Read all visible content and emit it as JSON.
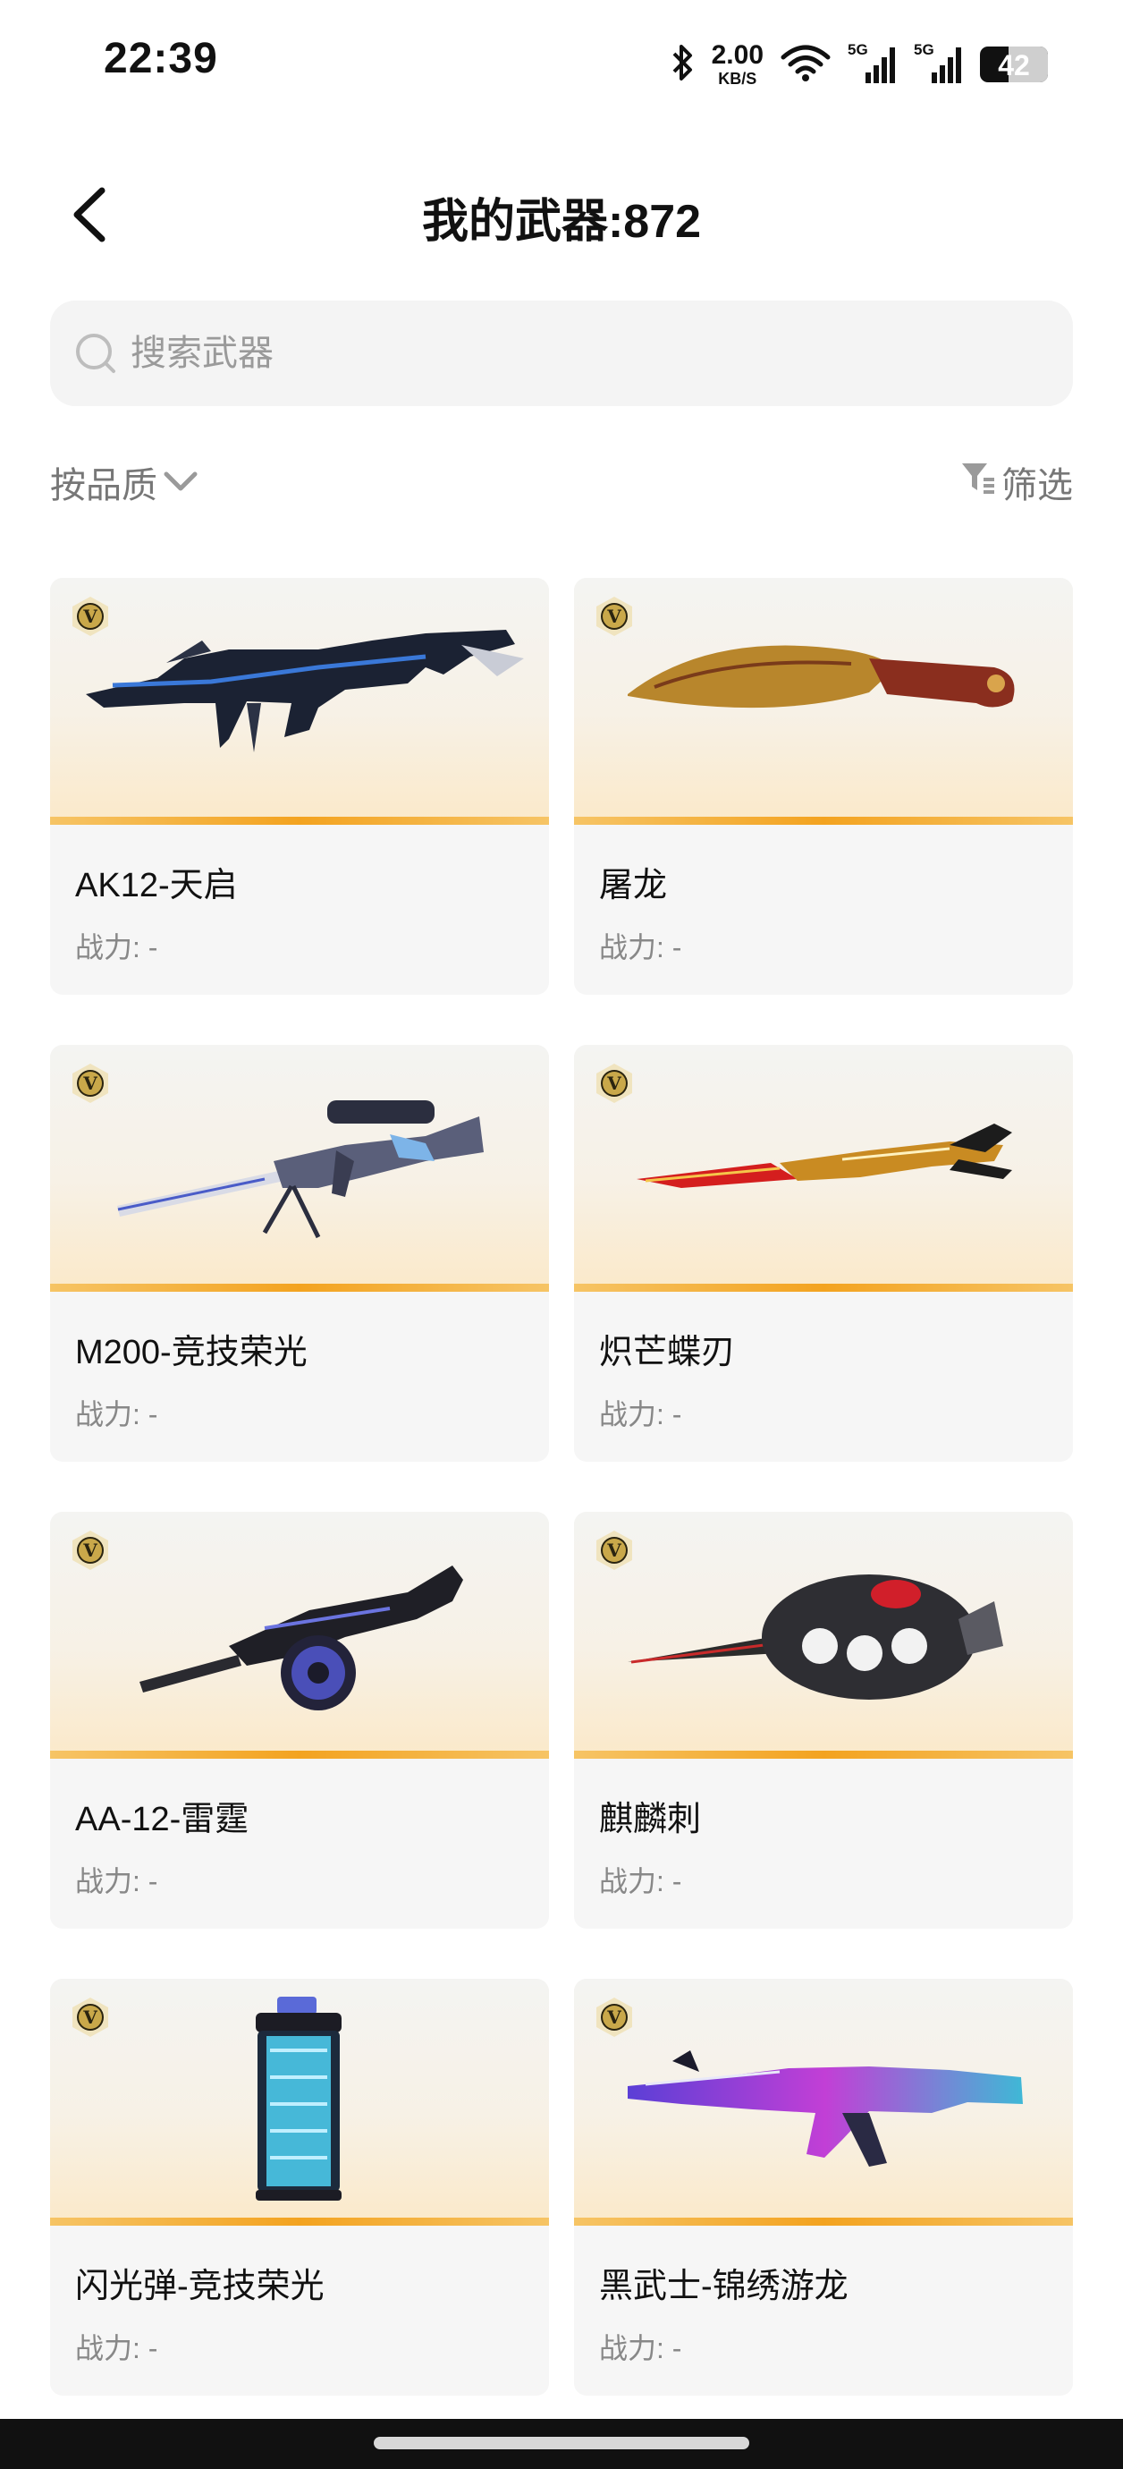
{
  "status_bar": {
    "time": "22:39",
    "net_speed_value": "2.00",
    "net_speed_unit": "KB/S",
    "signal_1_label": "5G",
    "signal_2_label": "5G",
    "battery": "42",
    "icons": [
      "bluetooth-icon",
      "wifi-icon",
      "signal-icon",
      "signal-icon",
      "battery-icon"
    ]
  },
  "header": {
    "title": "我的武器:872",
    "back_icon": "chevron-left-icon"
  },
  "search": {
    "placeholder": "搜索武器",
    "icon": "search-icon"
  },
  "toolbar": {
    "sort_label": "按品质",
    "sort_icon": "chevron-down-icon",
    "filter_label": "筛选",
    "filter_icon": "filter-icon"
  },
  "weapons": [
    {
      "name": "AK12-天启",
      "power": "战力: -",
      "badge": "V",
      "icon": "rifle-icon"
    },
    {
      "name": "屠龙",
      "power": "战力: -",
      "badge": "V",
      "icon": "knife-icon"
    },
    {
      "name": "M200-竞技荣光",
      "power": "战力: -",
      "badge": "V",
      "icon": "sniper-rifle-icon"
    },
    {
      "name": "炽芒蝶刃",
      "power": "战力: -",
      "badge": "V",
      "icon": "butterfly-knife-icon"
    },
    {
      "name": "AA-12-雷霆",
      "power": "战力: -",
      "badge": "V",
      "icon": "shotgun-icon"
    },
    {
      "name": "麒麟刺",
      "power": "战力: -",
      "badge": "V",
      "icon": "knuckle-blade-icon"
    },
    {
      "name": "闪光弹-竞技荣光",
      "power": "战力: -",
      "badge": "V",
      "icon": "flashbang-icon"
    },
    {
      "name": "黑武士-锦绣游龙",
      "power": "战力: -",
      "badge": "V",
      "icon": "assault-rifle-icon"
    }
  ],
  "colors": {
    "accent": "#f3a320",
    "card_bg": "#f6f6f6",
    "muted_text": "#888888"
  }
}
